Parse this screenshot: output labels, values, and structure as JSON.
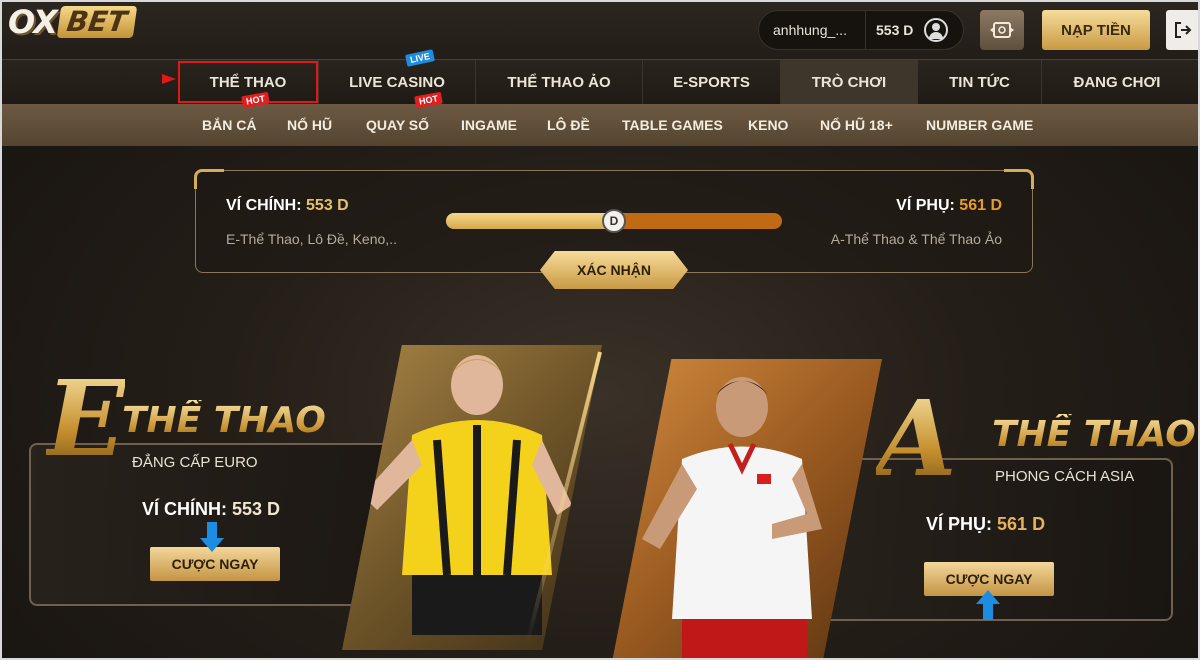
{
  "header": {
    "logo_ox": "OX",
    "logo_bet": "BET",
    "username": "anhhung_...",
    "balance": "553 D",
    "deposit_label": "NẠP TIỀN"
  },
  "main_nav": [
    {
      "label": "THỂ THAO"
    },
    {
      "label": "LIVE CASINO"
    },
    {
      "label": "THỂ THAO ẢO"
    },
    {
      "label": "E-SPORTS"
    },
    {
      "label": "TRÒ CHƠI"
    },
    {
      "label": "TIN TỨC"
    },
    {
      "label": "ĐANG CHƠI"
    }
  ],
  "badges": {
    "live": "LIVE",
    "hot": "HOT"
  },
  "sub_nav": [
    {
      "label": "BẮN CÁ"
    },
    {
      "label": "NỔ HŨ"
    },
    {
      "label": "QUAY SỐ"
    },
    {
      "label": "INGAME"
    },
    {
      "label": "LÔ ĐỀ"
    },
    {
      "label": "TABLE GAMES"
    },
    {
      "label": "KENO"
    },
    {
      "label": "NỔ HŨ 18+"
    },
    {
      "label": "NUMBER GAME"
    }
  ],
  "wallet": {
    "main_label": "VÍ CHÍNH:",
    "main_amount": "553 D",
    "main_desc": "E-Thể Thao, Lô Đề, Keno,..",
    "sub_label": "VÍ PHỤ:",
    "sub_amount": "561 D",
    "sub_desc": "A-Thể Thao & Thể Thao Ảo",
    "slider_knob": "D",
    "slider_fraction": 0.5,
    "confirm_label": "XÁC NHẬN"
  },
  "promo_left": {
    "big_letter": "E",
    "title": "THỂ THAO",
    "subtitle": "ĐẲNG CẤP EURO",
    "wallet_label": "VÍ CHÍNH:",
    "wallet_amount": "553 D",
    "bet_label": "CƯỢC NGAY"
  },
  "promo_right": {
    "big_letter": "A",
    "title": "THỂ THAO",
    "subtitle": "PHONG CÁCH ASIA",
    "wallet_label": "VÍ PHỤ:",
    "wallet_amount": "561 D",
    "bet_label": "CƯỢC NGAY"
  },
  "colors": {
    "gold": "#d4ac5c",
    "highlight": "#e01818",
    "accent_blue": "#1c8de0"
  }
}
